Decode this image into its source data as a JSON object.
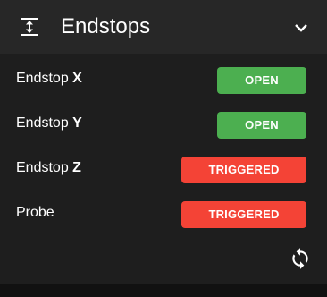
{
  "header": {
    "title": "Endstops",
    "icon": "vertical-align-icon",
    "chevron": "chevron-down-icon"
  },
  "endstops": [
    {
      "label": "Endstop ",
      "axis": "X",
      "status": "OPEN",
      "state": "open"
    },
    {
      "label": "Endstop ",
      "axis": "Y",
      "status": "OPEN",
      "state": "open"
    },
    {
      "label": "Endstop ",
      "axis": "Z",
      "status": "TRIGGERED",
      "state": "triggered"
    },
    {
      "label": "Probe",
      "axis": "",
      "status": "TRIGGERED",
      "state": "triggered"
    }
  ],
  "actions": {
    "refresh_icon": "refresh-icon"
  },
  "colors": {
    "open": "#4caf50",
    "triggered": "#f44336",
    "header_bg": "#272727",
    "panel_bg": "#1e1e1e"
  }
}
